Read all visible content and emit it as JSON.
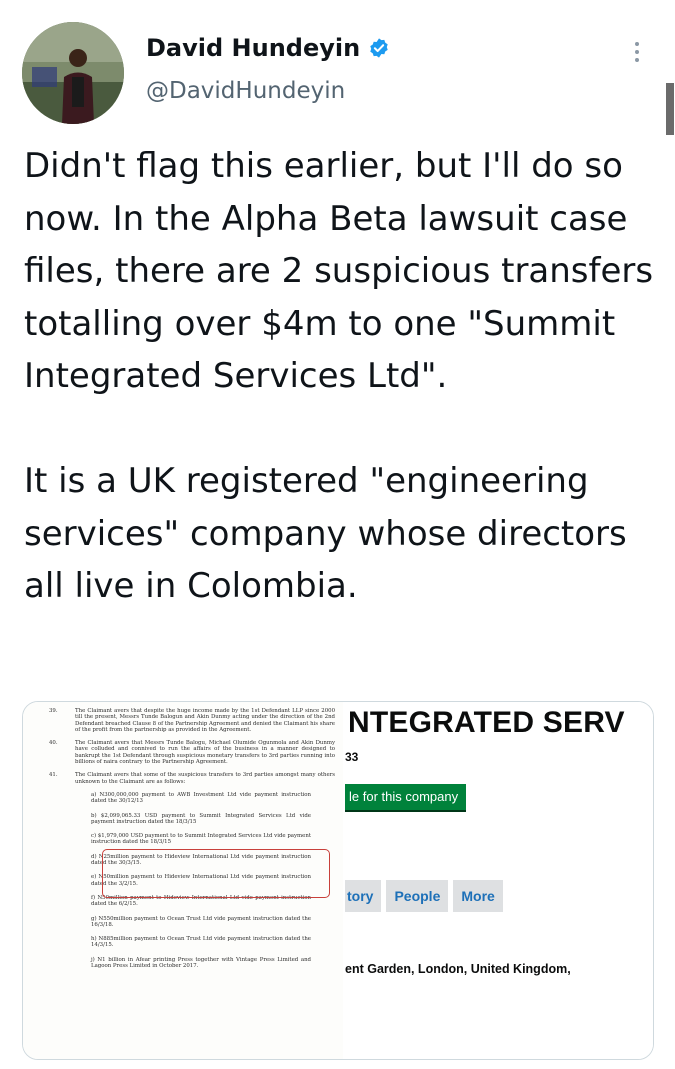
{
  "tweet": {
    "author_name": "David Hundeyin",
    "handle": "@DavidHundeyin",
    "text": "Didn't flag this earlier, but I'll do so now. In the Alpha Beta lawsuit case files, there are 2 suspicious transfers totalling over $4m to one \"Summit Integrated Services Ltd\".\n\nIt is a UK registered \"engineering services\" company whose directors all live in Colombia."
  },
  "icons": {
    "verified": "verified-badge-icon",
    "more": "more-options-icon"
  },
  "colors": {
    "verified_blue": "#1d9bf0",
    "follow_green": "#00823b",
    "tab_link": "#1d70b8",
    "highlight_red": "#c8403b"
  },
  "document": {
    "paragraphs": [
      {
        "num": "39.",
        "text": "The Claimant avers that despite the huge income made by the 1st Defendant LLP since 2000 till the present, Messrs Tunde Balogun and Akin Dunmy acting under the direction of the 2nd Defendant breached Clause 8 of the Partnership Agreement and denied the Claimant his share of the profit from the partnership as provided in the Agreement."
      },
      {
        "num": "40.",
        "text": "The Claimant avers that Messrs Tunde Balogu, Michael Olumide Ogunmola and Akin Dunmy have colluded and connived to run the affairs of the business in a manner designed to bankrupt the 1st Defendant through suspicious monetary transfers to 3rd parties running into billions of naira contrary to the Partnership Agreement."
      },
      {
        "num": "41.",
        "text": "The Claimant avers that some of the suspicious transfers to 3rd parties amongst many others unknown to the Claimant are as follows:"
      }
    ],
    "items": [
      "a) N300,000,000 payment to AWB Investment Ltd vide payment instruction dated the 30/12/13",
      "b) $2,099,065.33 USD payment to Summit Integrated Services Ltd vide payment instruction dated the 18/3/15",
      "c) $1,979,000 USD payment to to Summit Integrated Services Ltd vide payment instruction dated the 18/3/15",
      "d) N25million payment to Hideview International Ltd vide payment instruction dated the 30/3/15.",
      "e) N50million payment to Hideview International Ltd vide payment instruction dated the 3/2/15.",
      "f) N50million payment to Hideview International Ltd vide payment instruction dated the 6/2/15.",
      "g) N550million payment to Ocean Trust Ltd vide payment instruction dated the 16/3/18.",
      "h) N885million payment to Ocean Trust Ltd vide payment instruction dated the 14/3/15.",
      "j) N1 billion in Afear printing Press together with Vintage Press Limited and Lagoon Press Limited in October 2017."
    ]
  },
  "company_page": {
    "title": "NTEGRATED SERV",
    "number_fragment": "33",
    "follow_button": "le for this company",
    "tabs": [
      "tory",
      "People",
      "More"
    ],
    "address": "ent Garden, London, United Kingdom,"
  }
}
